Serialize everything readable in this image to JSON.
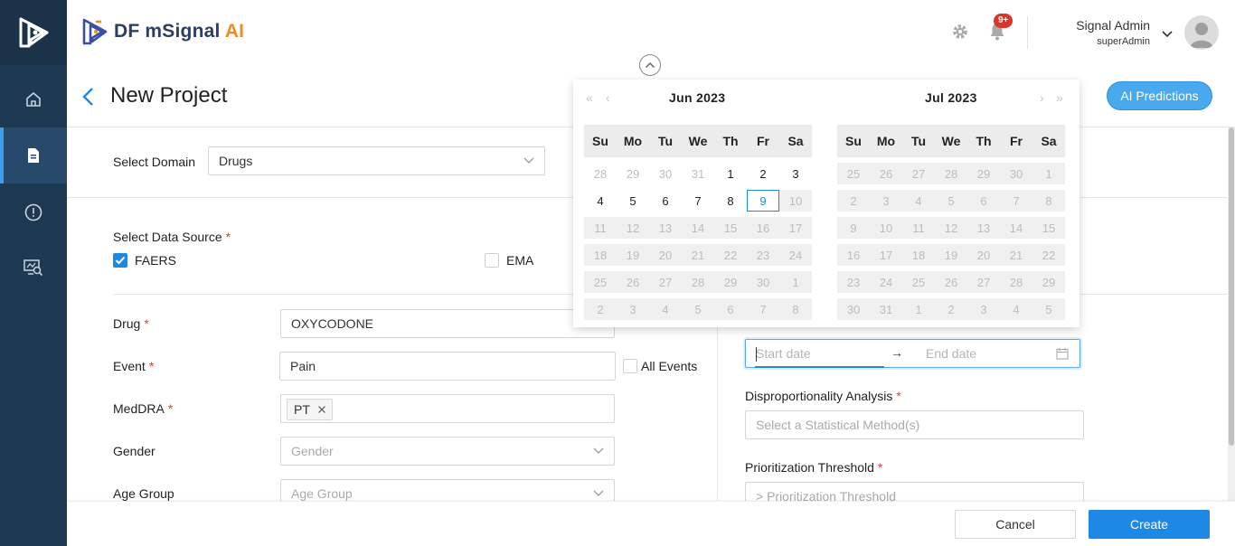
{
  "app": {
    "brand_prefix": "DF mSignal",
    "brand_suffix": "AI"
  },
  "header": {
    "notif_badge": "9+",
    "user_name": "Signal Admin",
    "user_role": "superAdmin"
  },
  "page": {
    "title": "New Project",
    "ai_button": "AI Predictions"
  },
  "form": {
    "domain_label": "Select Domain",
    "domain_value": "Drugs",
    "datasource_label": "Select Data Source",
    "req": "*",
    "faers_label": "FAERS",
    "ema_label": "EMA",
    "drug_label": "Drug",
    "drug_value": "OXYCODONE",
    "event_label": "Event",
    "event_value": "Pain",
    "all_events_label": "All Events",
    "meddra_label": "MedDRA",
    "meddra_tag": "PT",
    "gender_label": "Gender",
    "gender_placeholder": "Gender",
    "agegroup_label": "Age Group",
    "agegroup_placeholder": "Age Group",
    "start_placeholder": "Start date",
    "range_arrow": "→",
    "end_placeholder": "End date",
    "dpa_label": "Disproportionality Analysis",
    "dpa_placeholder": "Select a Statistical Method(s)",
    "threshold_label": "Prioritization Threshold",
    "threshold_placeholder": "> Prioritization Threshold"
  },
  "footer": {
    "cancel": "Cancel",
    "create": "Create"
  },
  "picker": {
    "left_month": "Jun  2023",
    "right_month": "Jul  2023",
    "nav_prev_year": "«",
    "nav_prev_month": "‹",
    "nav_next_month": "›",
    "nav_next_year": "»",
    "weekdays": [
      "Su",
      "Mo",
      "Tu",
      "We",
      "Th",
      "Fr",
      "Sa"
    ],
    "left_days": [
      [
        [
          "28",
          "out"
        ],
        [
          "29",
          "out"
        ],
        [
          "30",
          "out"
        ],
        [
          "31",
          "out"
        ],
        [
          "1",
          ""
        ],
        [
          "2",
          ""
        ],
        [
          "3",
          ""
        ]
      ],
      [
        [
          "4",
          ""
        ],
        [
          "5",
          ""
        ],
        [
          "6",
          ""
        ],
        [
          "7",
          ""
        ],
        [
          "8",
          ""
        ],
        [
          "9",
          "today"
        ],
        [
          "10",
          "dis"
        ]
      ],
      [
        [
          "11",
          "dis"
        ],
        [
          "12",
          "dis"
        ],
        [
          "13",
          "dis"
        ],
        [
          "14",
          "dis"
        ],
        [
          "15",
          "dis"
        ],
        [
          "16",
          "dis"
        ],
        [
          "17",
          "dis"
        ]
      ],
      [
        [
          "18",
          "dis"
        ],
        [
          "19",
          "dis"
        ],
        [
          "20",
          "dis"
        ],
        [
          "21",
          "dis"
        ],
        [
          "22",
          "dis"
        ],
        [
          "23",
          "dis"
        ],
        [
          "24",
          "dis"
        ]
      ],
      [
        [
          "25",
          "dis"
        ],
        [
          "26",
          "dis"
        ],
        [
          "27",
          "dis"
        ],
        [
          "28",
          "dis"
        ],
        [
          "29",
          "dis"
        ],
        [
          "30",
          "dis"
        ],
        [
          "1",
          "dis"
        ]
      ],
      [
        [
          "2",
          "dis"
        ],
        [
          "3",
          "dis"
        ],
        [
          "4",
          "dis"
        ],
        [
          "5",
          "dis"
        ],
        [
          "6",
          "dis"
        ],
        [
          "7",
          "dis"
        ],
        [
          "8",
          "dis"
        ]
      ]
    ],
    "right_days": [
      [
        [
          "25",
          "dis"
        ],
        [
          "26",
          "dis"
        ],
        [
          "27",
          "dis"
        ],
        [
          "28",
          "dis"
        ],
        [
          "29",
          "dis"
        ],
        [
          "30",
          "dis"
        ],
        [
          "1",
          "dis"
        ]
      ],
      [
        [
          "2",
          "dis"
        ],
        [
          "3",
          "dis"
        ],
        [
          "4",
          "dis"
        ],
        [
          "5",
          "dis"
        ],
        [
          "6",
          "dis"
        ],
        [
          "7",
          "dis"
        ],
        [
          "8",
          "dis"
        ]
      ],
      [
        [
          "9",
          "dis"
        ],
        [
          "10",
          "dis"
        ],
        [
          "11",
          "dis"
        ],
        [
          "12",
          "dis"
        ],
        [
          "13",
          "dis"
        ],
        [
          "14",
          "dis"
        ],
        [
          "15",
          "dis"
        ]
      ],
      [
        [
          "16",
          "dis"
        ],
        [
          "17",
          "dis"
        ],
        [
          "18",
          "dis"
        ],
        [
          "19",
          "dis"
        ],
        [
          "20",
          "dis"
        ],
        [
          "21",
          "dis"
        ],
        [
          "22",
          "dis"
        ]
      ],
      [
        [
          "23",
          "dis"
        ],
        [
          "24",
          "dis"
        ],
        [
          "25",
          "dis"
        ],
        [
          "26",
          "dis"
        ],
        [
          "27",
          "dis"
        ],
        [
          "28",
          "dis"
        ],
        [
          "29",
          "dis"
        ]
      ],
      [
        [
          "30",
          "dis"
        ],
        [
          "31",
          "dis"
        ],
        [
          "1",
          "dis"
        ],
        [
          "2",
          "dis"
        ],
        [
          "3",
          "dis"
        ],
        [
          "4",
          "dis"
        ],
        [
          "5",
          "dis"
        ]
      ]
    ]
  },
  "icons": {
    "rail": [
      "app-logo-icon",
      "home-icon",
      "document-icon",
      "alert-circle-icon",
      "monitor-search-icon"
    ],
    "header": [
      "gear-icon",
      "bell-icon",
      "chevron-down-icon",
      "avatar-icon"
    ]
  },
  "colors": {
    "rail": "#1e3a52",
    "accent": "#1e88e5",
    "brand_orange": "#f08a24",
    "ai_button": "#49a9ee",
    "badge": "#d9362b"
  }
}
